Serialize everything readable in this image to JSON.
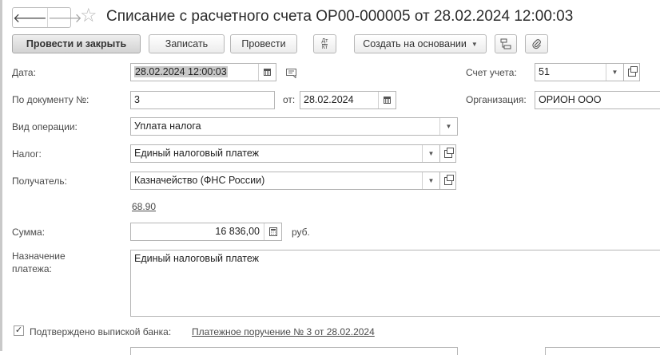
{
  "header": {
    "back": "🡐",
    "forward": "🡒",
    "title": "Списание с расчетного счета ОР00-000005 от 28.02.2024 12:00:03"
  },
  "toolbar": {
    "post_close": "Провести и закрыть",
    "save": "Записать",
    "post": "Провести",
    "dtkt_top": "Дт",
    "dtkt_bottom": "Кт",
    "create_based": "Создать на основании"
  },
  "form": {
    "date_label": "Дата:",
    "date_value": "28.02.2024 12:00:03",
    "account_label": "Счет учета:",
    "account_value": "51",
    "doc_num_label": "По документу №:",
    "doc_num_value": "3",
    "from_label": "от:",
    "from_value": "28.02.2024",
    "org_label": "Организация:",
    "org_value": "ОРИОН ООО",
    "op_type_label": "Вид операции:",
    "op_type_value": "Уплата налога",
    "tax_label": "Налог:",
    "tax_value": "Единый налоговый платеж",
    "recipient_label": "Получатель:",
    "recipient_value": "Казначейство (ФНС России)",
    "recipient_account_link": "68.90",
    "sum_label": "Сумма:",
    "sum_value": "16 836,00",
    "currency": "руб.",
    "purpose_label_1": "Назначение",
    "purpose_label_2": "платежа:",
    "purpose_value": "Единый налоговый платеж",
    "confirmed_label": "Подтверждено выпиской банка:",
    "confirmed_checked": true,
    "payment_order_link": "Платежное поручение № 3 от 28.02.2024"
  }
}
